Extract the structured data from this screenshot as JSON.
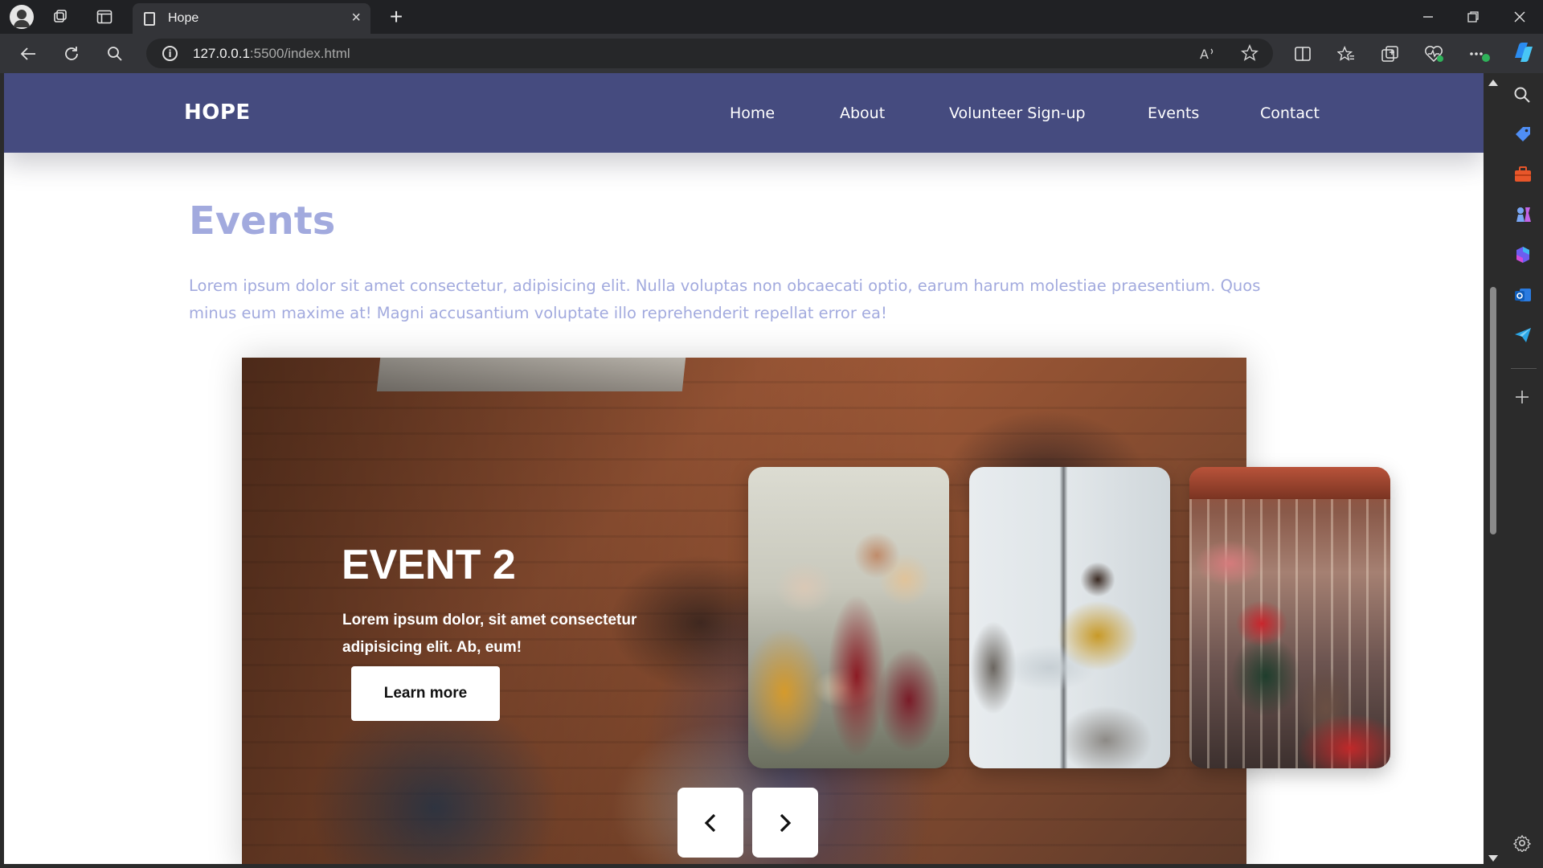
{
  "browser": {
    "tab_title": "Hope",
    "tab_close": "×",
    "new_tab": "+",
    "url_host": "127.0.0.1",
    "url_rest": ":5500/index.html",
    "icons": [
      "profile-icon",
      "workspaces-icon",
      "tab-actions-icon",
      "page-icon",
      "back-icon",
      "refresh-icon",
      "search-icon",
      "info-icon",
      "read-aloud-icon",
      "favorite-star-icon",
      "split-screen-icon",
      "favorites-icon",
      "collections-icon",
      "browser-essentials-icon",
      "more-icon",
      "copilot-icon"
    ]
  },
  "site": {
    "logo": "HOPE",
    "nav": [
      "Home",
      "About",
      "Volunteer Sign-up",
      "Events",
      "Contact"
    ]
  },
  "events": {
    "title": "Events",
    "intro": "Lorem ipsum dolor sit amet consectetur, adipisicing elit. Nulla voluptas non obcaecati optio, earum harum molestiae praesentium. Quos minus eum maxime at! Magni accusantium voluptate illo reprehenderit repellat error ea!"
  },
  "slider": {
    "title": "EVENT 2",
    "text": "Lorem ipsum dolor, sit amet consectetur adipisicing elit. Ab, eum!",
    "button": "Learn more",
    "prev_glyph": "‹",
    "next_glyph": "›"
  },
  "colors": {
    "header_bg": "#454b7f",
    "accent_text": "#a2aade"
  }
}
